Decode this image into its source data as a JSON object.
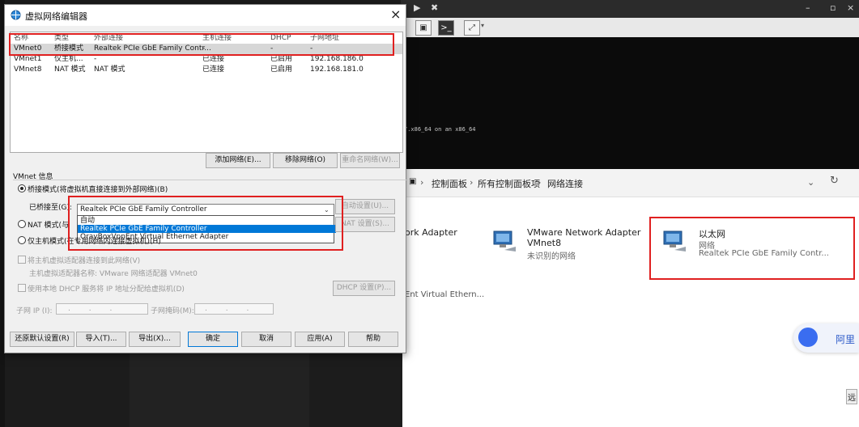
{
  "dialog": {
    "title": "虚拟网络编辑器",
    "close": "×",
    "columns": [
      "名称",
      "类型",
      "外部连接",
      "主机连接",
      "DHCP",
      "子网地址"
    ],
    "rows": [
      [
        "VMnet0",
        "桥接模式",
        "Realtek PCIe GbE Family Contr...",
        "-",
        "-",
        "-"
      ],
      [
        "VMnet1",
        "仅主机...",
        "-",
        "已连接",
        "已启用",
        "192.168.186.0"
      ],
      [
        "VMnet8",
        "NAT 模式",
        "NAT 模式",
        "已连接",
        "已启用",
        "192.168.181.0"
      ]
    ],
    "add_network": "添加网络(E)...",
    "remove_network": "移除网络(O)",
    "rename_network": "重命名网络(W)...",
    "vmnet_info": "VMnet 信息",
    "bridged_mode": "桥接模式(将虚拟机直接连接到外部网络)(B)",
    "bridged_to": "已桥接至(G):",
    "bridged_selected": "Realtek PCIe GbE Family Controller",
    "auto_settings": "自动设置(U)...",
    "dropdown_options": [
      "自动",
      "Realtek PCIe GbE Family Controller",
      "OrayBoxVpnEnt Virtual Ethernet Adapter"
    ],
    "nat_mode": "NAT 模式(与",
    "nat_settings": "NAT 设置(S)...",
    "host_only": "仅主机模式(在专用网络内连接虚拟机)(H)",
    "connect_host_adapter": "将主机虚拟适配器连接到此网络(V)",
    "host_adapter_name": "主机虚拟适配器名称: VMware 网络适配器 VMnet0",
    "use_dhcp": "使用本地 DHCP 服务将 IP 地址分配给虚拟机(D)",
    "dhcp_settings": "DHCP 设置(P)...",
    "subnet_ip": "子网 IP (I):",
    "subnet_mask": "子网掩码(M):",
    "ip_placeholder": ". . .",
    "restore_defaults": "还原默认设置(R)",
    "import": "导入(T)...",
    "export": "导出(X)...",
    "ok": "确定",
    "cancel": "取消",
    "apply": "应用(A)",
    "help": "帮助"
  },
  "explorer": {
    "breadcrumb": [
      "控制面板",
      "所有控制面板项",
      "网络连接"
    ],
    "adapters": [
      {
        "name": "ork Adapter",
        "line2": "",
        "line3": ""
      },
      {
        "name": "VMware Network Adapter",
        "line2": "VMnet8",
        "line3": "未识别的网络"
      },
      {
        "name": "以太网",
        "line2": "网络",
        "line3": "Realtek PCIe GbE Family Contr..."
      }
    ],
    "partial_adapter": "Ent Virtual Ethern...",
    "bubble_label": "阿里",
    "corner_text": "远"
  },
  "vm": {
    "console_text": "7.x86_64 on an x86_64"
  }
}
